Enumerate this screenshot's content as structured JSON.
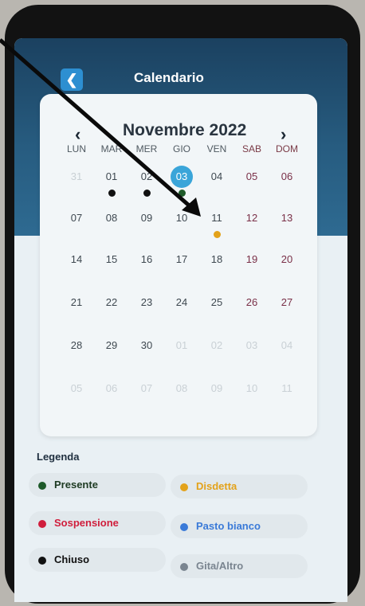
{
  "header": {
    "title": "Calendario",
    "back_icon": "chevron-left-icon"
  },
  "calendar": {
    "month_label": "Novembre 2022",
    "prev_icon": "chevron-left-icon",
    "next_icon": "chevron-right-icon",
    "weekdays": [
      "LUN",
      "MAR",
      "MER",
      "GIO",
      "VEN",
      "SAB",
      "DOM"
    ],
    "weeks": [
      [
        "31",
        "01",
        "02",
        "03",
        "04",
        "05",
        "06"
      ],
      [
        "07",
        "08",
        "09",
        "10",
        "11",
        "12",
        "13"
      ],
      [
        "14",
        "15",
        "16",
        "17",
        "18",
        "19",
        "20"
      ],
      [
        "21",
        "22",
        "23",
        "24",
        "25",
        "26",
        "27"
      ],
      [
        "28",
        "29",
        "30",
        "01",
        "02",
        "03",
        "04"
      ],
      [
        "05",
        "06",
        "07",
        "08",
        "09",
        "10",
        "11"
      ]
    ],
    "today": "03",
    "markers": [
      {
        "day": "01",
        "status": "Chiuso"
      },
      {
        "day": "02",
        "status": "Chiuso"
      },
      {
        "day": "03",
        "status": "Presente"
      },
      {
        "day": "11",
        "status": "Disdetta"
      }
    ]
  },
  "legend": {
    "title": "Legenda",
    "items": [
      {
        "label": "Presente",
        "color": "#1e5a2a"
      },
      {
        "label": "Disdetta",
        "color": "#e3a21a"
      },
      {
        "label": "Sospensione",
        "color": "#d01e3c"
      },
      {
        "label": "Pasto bianco",
        "color": "#3a7ad8"
      },
      {
        "label": "Chiuso",
        "color": "#111111"
      },
      {
        "label": "Gita/Altro",
        "color": "#7a8590"
      }
    ]
  },
  "colors": {
    "header": "#1b4160",
    "today_highlight": "#3aa5d9",
    "arrow": "#0a0a0a"
  }
}
